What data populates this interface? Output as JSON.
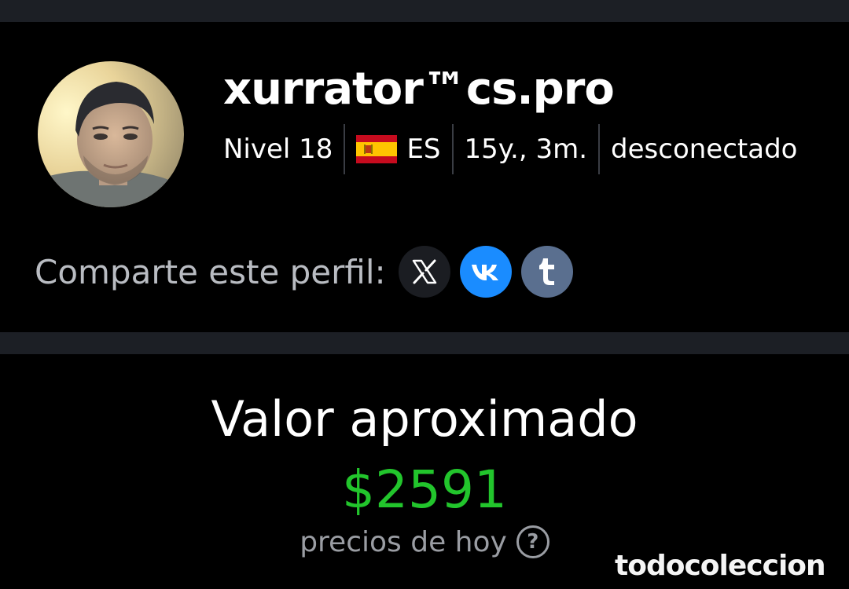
{
  "profile": {
    "username": "xurrator™cs.pro",
    "level": "Nivel 18",
    "country_code": "ES",
    "account_age": "15y., 3m.",
    "status": "desconectado"
  },
  "share": {
    "label": "Comparte este perfil:",
    "buttons": [
      {
        "name": "X",
        "icon": "x-icon",
        "color": "#1b1d22"
      },
      {
        "name": "VK",
        "icon": "vk-icon",
        "color": "#1a8cff"
      },
      {
        "name": "Tumblr",
        "icon": "tumblr-icon",
        "color": "#5a6f8f"
      }
    ]
  },
  "valuation": {
    "title": "Valor aproximado",
    "amount": "$2591",
    "note": "precios de hoy",
    "help_icon": "?",
    "amount_color": "#22c52c"
  },
  "watermark": "todocoleccion"
}
